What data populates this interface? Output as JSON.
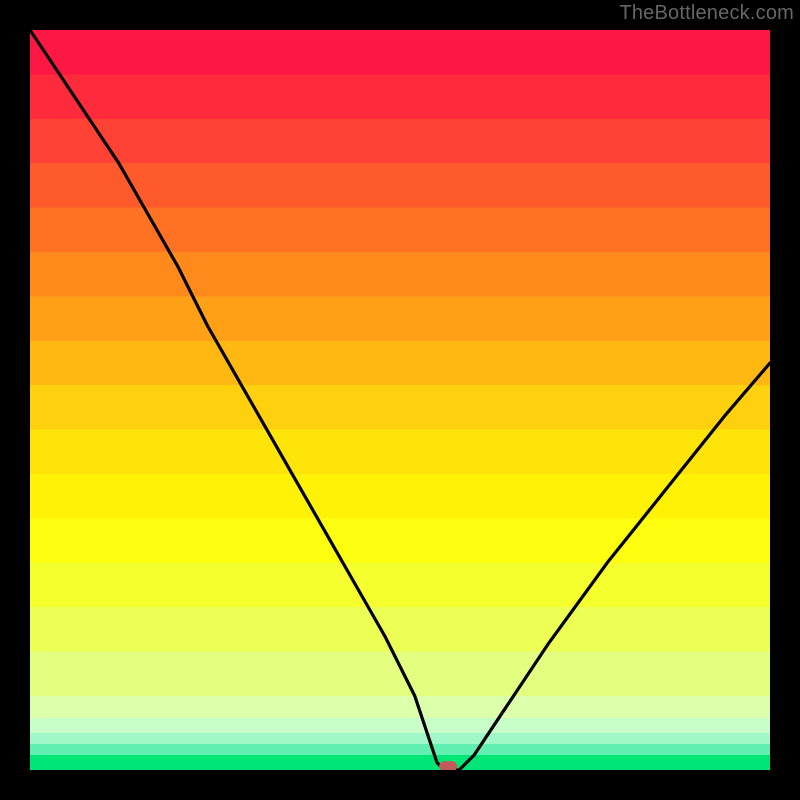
{
  "watermark": "TheBottleneck.com",
  "chart_data": {
    "type": "line",
    "title": "",
    "xlabel": "",
    "ylabel": "",
    "xlim": [
      0,
      100
    ],
    "ylim": [
      0,
      100
    ],
    "background_bands": [
      {
        "y0": 94,
        "y1": 100,
        "color": "#ff1744"
      },
      {
        "y0": 88,
        "y1": 94,
        "color": "#ff2a3c"
      },
      {
        "y0": 82,
        "y1": 88,
        "color": "#ff4233"
      },
      {
        "y0": 76,
        "y1": 82,
        "color": "#ff5a2b"
      },
      {
        "y0": 70,
        "y1": 76,
        "color": "#ff7223"
      },
      {
        "y0": 64,
        "y1": 70,
        "color": "#ff8a1c"
      },
      {
        "y0": 58,
        "y1": 64,
        "color": "#ffa016"
      },
      {
        "y0": 52,
        "y1": 58,
        "color": "#ffb812"
      },
      {
        "y0": 46,
        "y1": 52,
        "color": "#ffd00e"
      },
      {
        "y0": 40,
        "y1": 46,
        "color": "#ffe40a"
      },
      {
        "y0": 34,
        "y1": 40,
        "color": "#fff207"
      },
      {
        "y0": 28,
        "y1": 34,
        "color": "#fdfe10"
      },
      {
        "y0": 22,
        "y1": 28,
        "color": "#f5ff2e"
      },
      {
        "y0": 16,
        "y1": 22,
        "color": "#ecff55"
      },
      {
        "y0": 10,
        "y1": 16,
        "color": "#e4ff80"
      },
      {
        "y0": 7,
        "y1": 10,
        "color": "#dbffaa"
      },
      {
        "y0": 5,
        "y1": 7,
        "color": "#c8ffc8"
      },
      {
        "y0": 3.5,
        "y1": 5,
        "color": "#a0f7c8"
      },
      {
        "y0": 2,
        "y1": 3.5,
        "color": "#60efb0"
      },
      {
        "y0": 0,
        "y1": 2,
        "color": "#00e676"
      }
    ],
    "series": [
      {
        "name": "bottleneck-curve",
        "x": [
          0,
          4,
          8,
          12,
          16,
          20,
          24,
          28,
          32,
          36,
          40,
          44,
          48,
          52,
          54,
          55,
          56,
          58,
          60,
          64,
          70,
          78,
          86,
          94,
          100
        ],
        "y": [
          100,
          94,
          88,
          82,
          75,
          68,
          60,
          53,
          46,
          39,
          32,
          25,
          18,
          10,
          4,
          1,
          0,
          0,
          2,
          8,
          17,
          28,
          38,
          48,
          55
        ]
      }
    ],
    "marker": {
      "name": "optimal-point",
      "x": 56.5,
      "y": 0.5,
      "color": "#c35a5a",
      "rx": 9,
      "ry": 5
    },
    "curve_flat_segment": {
      "x0": 54.5,
      "x1": 58.3,
      "y": 0
    }
  }
}
